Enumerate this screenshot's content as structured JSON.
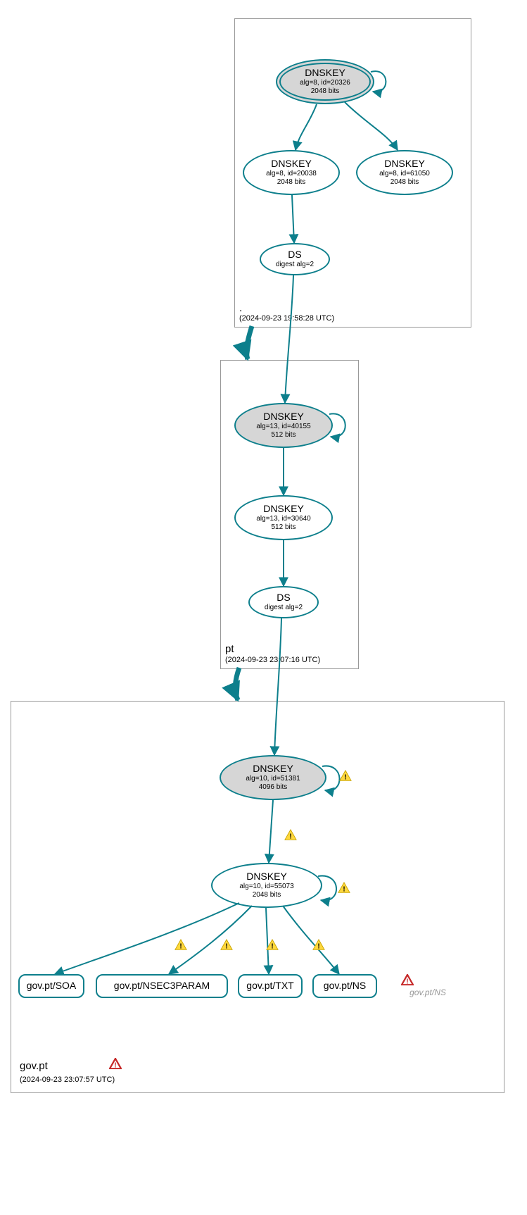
{
  "zones": {
    "root": {
      "label": ".",
      "timestamp": "(2024-09-23 19:58:28 UTC)"
    },
    "pt": {
      "label": "pt",
      "timestamp": "(2024-09-23 23:07:16 UTC)"
    },
    "gov": {
      "label": "gov.pt",
      "timestamp": "(2024-09-23 23:07:57 UTC)"
    }
  },
  "nodes": {
    "root_ksk": {
      "title": "DNSKEY",
      "line1": "alg=8, id=20326",
      "line2": "2048 bits"
    },
    "root_zsk1": {
      "title": "DNSKEY",
      "line1": "alg=8, id=20038",
      "line2": "2048 bits"
    },
    "root_zsk2": {
      "title": "DNSKEY",
      "line1": "alg=8, id=61050",
      "line2": "2048 bits"
    },
    "root_ds": {
      "title": "DS",
      "line1": "digest alg=2"
    },
    "pt_ksk": {
      "title": "DNSKEY",
      "line1": "alg=13, id=40155",
      "line2": "512 bits"
    },
    "pt_zsk": {
      "title": "DNSKEY",
      "line1": "alg=13, id=30640",
      "line2": "512 bits"
    },
    "pt_ds": {
      "title": "DS",
      "line1": "digest alg=2"
    },
    "gov_ksk": {
      "title": "DNSKEY",
      "line1": "alg=10, id=51381",
      "line2": "4096 bits"
    },
    "gov_zsk": {
      "title": "DNSKEY",
      "line1": "alg=10, id=55073",
      "line2": "2048 bits"
    },
    "rr_soa": {
      "label": "gov.pt/SOA"
    },
    "rr_nsec3": {
      "label": "gov.pt/NSEC3PARAM"
    },
    "rr_txt": {
      "label": "gov.pt/TXT"
    },
    "rr_ns": {
      "label": "gov.pt/NS"
    },
    "ghost_ns": {
      "label": "gov.pt/NS"
    }
  }
}
